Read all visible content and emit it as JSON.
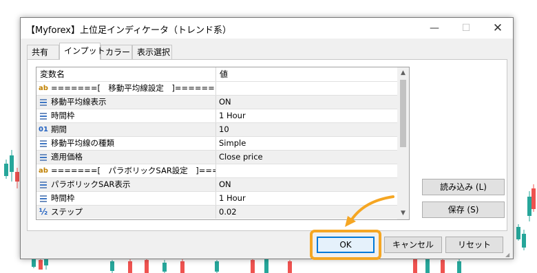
{
  "window": {
    "title": "【Myforex】上位足インディケータ（トレンド系）",
    "minimize_glyph": "—",
    "maximize_glyph": "☐",
    "close_glyph": "✕"
  },
  "tabs": [
    {
      "label": "共有",
      "active": false
    },
    {
      "label": "インプット",
      "active": true
    },
    {
      "label": "カラー",
      "active": false
    },
    {
      "label": "表示選択",
      "active": false
    }
  ],
  "grid": {
    "header_name": "変数名",
    "header_value": "値",
    "rows": [
      {
        "icon": "ab",
        "name": "=======[　移動平均線設定　]========",
        "value": ""
      },
      {
        "icon": "list",
        "name": "移動平均線表示",
        "value": "ON"
      },
      {
        "icon": "list",
        "name": "時間枠",
        "value": "1 Hour"
      },
      {
        "icon": "01",
        "name": "期間",
        "value": "10"
      },
      {
        "icon": "list",
        "name": "移動平均線の種類",
        "value": "Simple"
      },
      {
        "icon": "list",
        "name": "適用価格",
        "value": "Close price"
      },
      {
        "icon": "ab",
        "name": "=======[　パラボリックSAR設定　]======",
        "value": ""
      },
      {
        "icon": "list",
        "name": "パラボリックSAR表示",
        "value": "ON"
      },
      {
        "icon": "list",
        "name": "時間枠",
        "value": "1 Hour"
      },
      {
        "icon": "½",
        "name": "ステップ",
        "value": "0.02"
      }
    ]
  },
  "buttons": {
    "load": "読み込み (L)",
    "save": "保存 (S)",
    "ok": "OK",
    "cancel": "キャンセル",
    "reset": "リセット"
  },
  "colors": {
    "highlight": "#f5a623",
    "ok_focus": "#0078d7",
    "bull": "#26a69a",
    "bear": "#ef5350"
  },
  "icons": {
    "string": "ab-icon",
    "enum": "list-icon",
    "integer": "integer-icon",
    "double": "double-icon"
  }
}
